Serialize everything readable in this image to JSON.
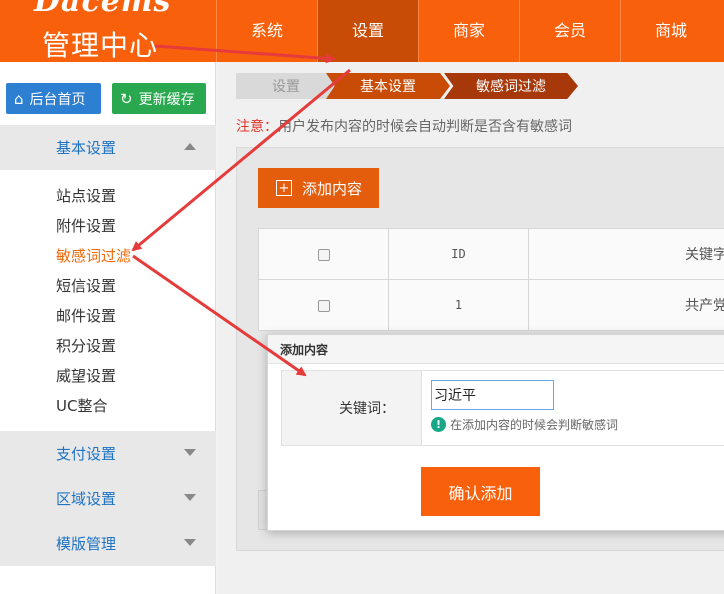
{
  "header": {
    "logo_text": "Dacems",
    "title": "管理中心",
    "nav": [
      "系统",
      "设置",
      "商家",
      "会员",
      "商城"
    ],
    "active_nav": "设置"
  },
  "sidebar": {
    "home_button": "后台首页",
    "refresh_button": "更新缓存",
    "sections": {
      "basic": "基本设置",
      "payment": "支付设置",
      "region": "区域设置",
      "template": "模版管理"
    },
    "sub_items": [
      "站点设置",
      "附件设置",
      "敏感词过滤",
      "短信设置",
      "邮件设置",
      "积分设置",
      "威望设置",
      "UC整合"
    ],
    "active_item": "敏感词过滤"
  },
  "breadcrumb": [
    "设置",
    "基本设置",
    "敏感词过滤"
  ],
  "notice": {
    "label": "注意：",
    "text": "用户发布内容的时候会自动判断是否含有敏感词"
  },
  "toolbar": {
    "add_label": "添加内容"
  },
  "table": {
    "headers": {
      "id": "ID",
      "keyword": "关键字"
    },
    "rows": [
      {
        "id": "1",
        "keyword": "共产党"
      }
    ]
  },
  "modal": {
    "title": "添加内容",
    "field_label": "关键词：",
    "input_value": "习近平",
    "hint": "在添加内容的时候会判断敏感词",
    "confirm_label": "确认添加"
  },
  "colors": {
    "brand_orange": "#f8600c",
    "active_nav": "#c84c06",
    "link_blue": "#1e73c4",
    "annotation_red": "#e53b3b"
  }
}
